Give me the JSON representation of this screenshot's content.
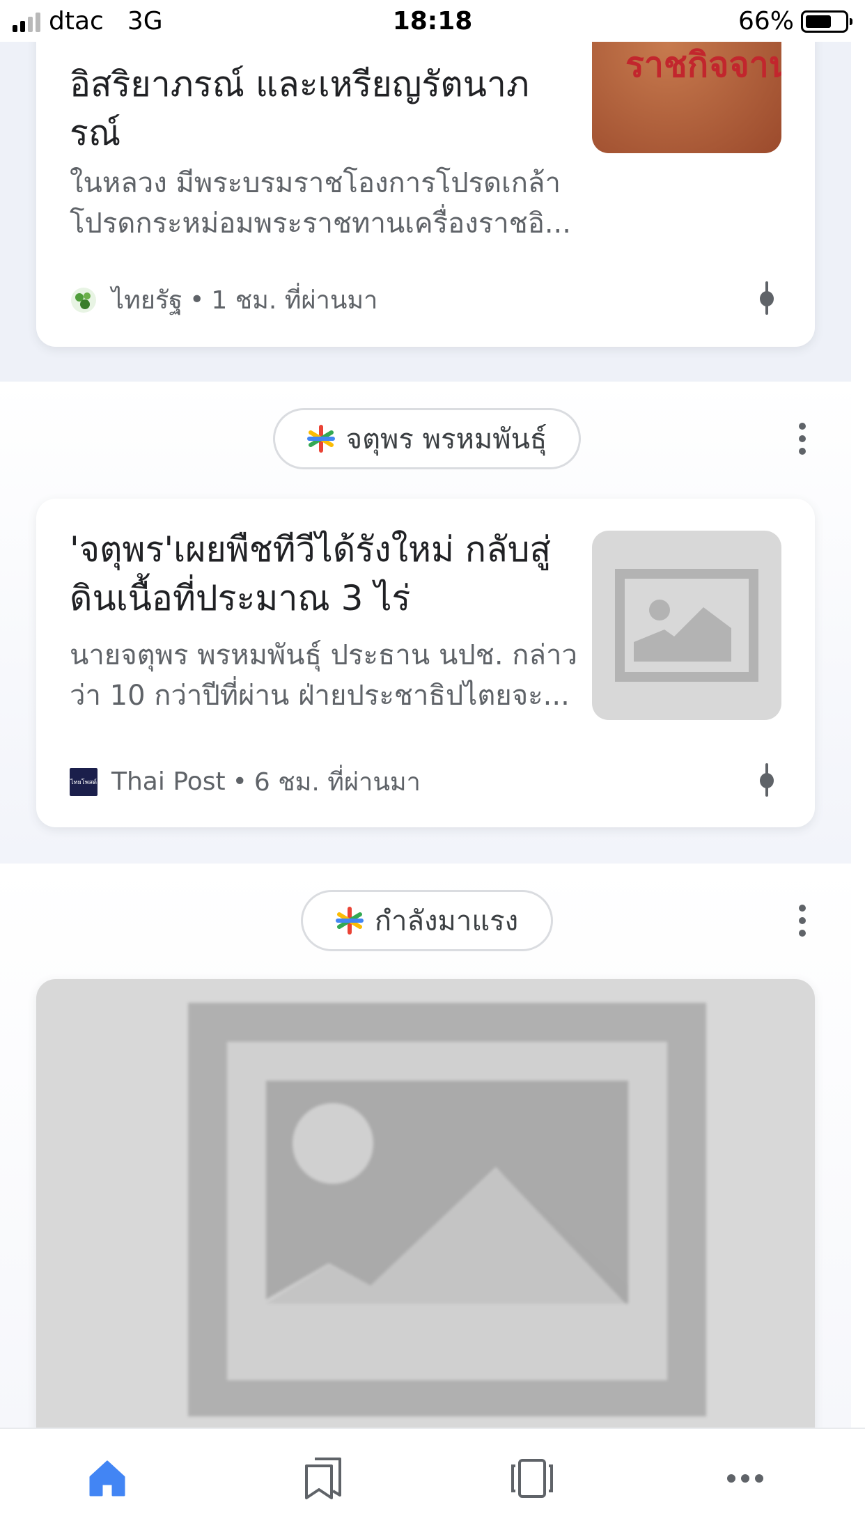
{
  "status_bar": {
    "carrier": "dtac",
    "network": "3G",
    "time": "18:18",
    "battery_percent": "66%",
    "battery_level": 0.66,
    "signal_bars_active": 2
  },
  "cards": [
    {
      "title_lines": [
        "อิสริยาภรณ์ และเหรียญรัตนาภ",
        "รณ์"
      ],
      "snippet_lines": [
        "ในหลวง มีพระบรมราชโองการโปรดเกล้า",
        "โปรดกระหม่อมพระราชทานเครื่องราชอิ..."
      ],
      "thumbnail_text": "ราชกิจจาน",
      "source": "ไทยรัฐ",
      "separator": "•",
      "time_ago": "1 ชม. ที่ผ่านมา"
    },
    {
      "title_lines": [
        "'จตุพร'เผยพืชทีวีได้รังใหม่ กลับสู่",
        "ดินเนื้อที่ประมาณ 3 ไร่"
      ],
      "snippet_lines": [
        "นายจตุพร พรหมพันธุ์ ประธาน นปช. กล่าว",
        "ว่า 10 กว่าปีที่ผ่าน ฝ่ายประชาธิปไตยจะ..."
      ],
      "source": "Thai Post",
      "source_logo_text": "ไทยโพสต์",
      "separator": "•",
      "time_ago": "6 ชม. ที่ผ่านมา"
    }
  ],
  "topics": [
    {
      "label": "จตุพร พรหมพันธุ์"
    },
    {
      "label": "กำลังมาแรง"
    }
  ],
  "colors": {
    "accent_blue": "#4285f4",
    "google_red": "#ea4335",
    "google_yellow": "#fbbc05",
    "google_green": "#34a853",
    "placeholder_gray": "#d8d8d8"
  },
  "bottom_nav": [
    {
      "icon": "home-icon",
      "active": true
    },
    {
      "icon": "bookmarks-icon",
      "active": false
    },
    {
      "icon": "tabs-icon",
      "active": false
    },
    {
      "icon": "more-icon",
      "active": false
    }
  ]
}
